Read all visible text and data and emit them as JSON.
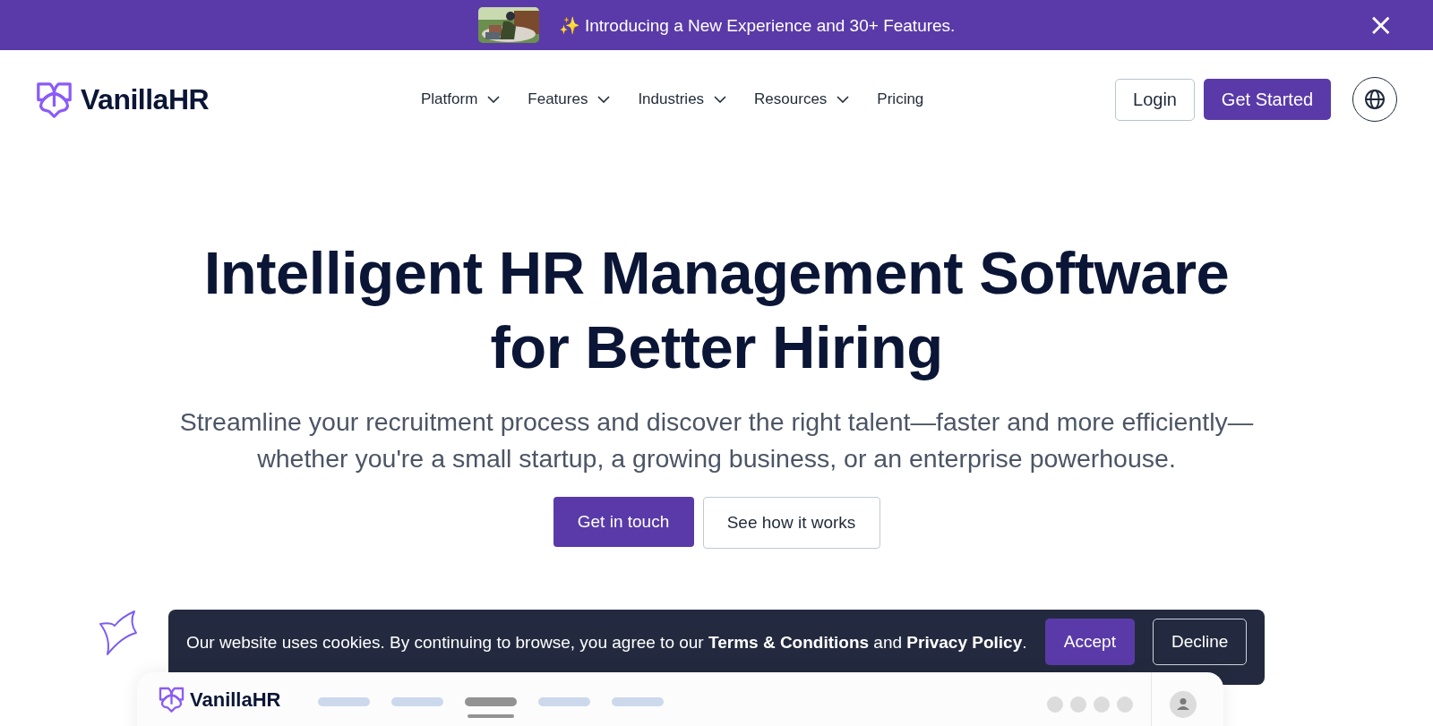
{
  "announcement": {
    "emoji": "✨",
    "text": "Introducing a New Experience and 30+ Features.",
    "close": "×"
  },
  "header": {
    "logo": "VanillaHR",
    "nav": [
      {
        "label": "Platform",
        "kind": "dropdown"
      },
      {
        "label": "Features",
        "kind": "dropdown"
      },
      {
        "label": "Industries",
        "kind": "dropdown"
      },
      {
        "label": "Resources",
        "kind": "dropdown"
      },
      {
        "label": "Pricing",
        "kind": "link"
      }
    ],
    "login": "Login",
    "cta": "Get Started"
  },
  "hero": {
    "title_lines": [
      "Intelligent HR Management Software",
      "for Better Hiring"
    ],
    "subtitle_lines": [
      "Streamline your recruitment process and discover the right talent—faster and more efficiently—",
      "whether you're a small startup, a growing business, or an enterprise powerhouse."
    ],
    "primary": "Get in touch",
    "secondary": "See how it works"
  },
  "cookie_banner": {
    "text": "Our website uses cookies. By continuing to browse, you agree to our **Terms & Conditions** and **Privacy Policy**.",
    "accept": "Accept",
    "decline": "Decline"
  },
  "preview": {
    "logo": "VanillaHR",
    "tabs": [
      {
        "selected": false
      },
      {
        "selected": false
      },
      {
        "selected": true
      },
      {
        "selected": false
      },
      {
        "selected": false
      }
    ]
  }
}
